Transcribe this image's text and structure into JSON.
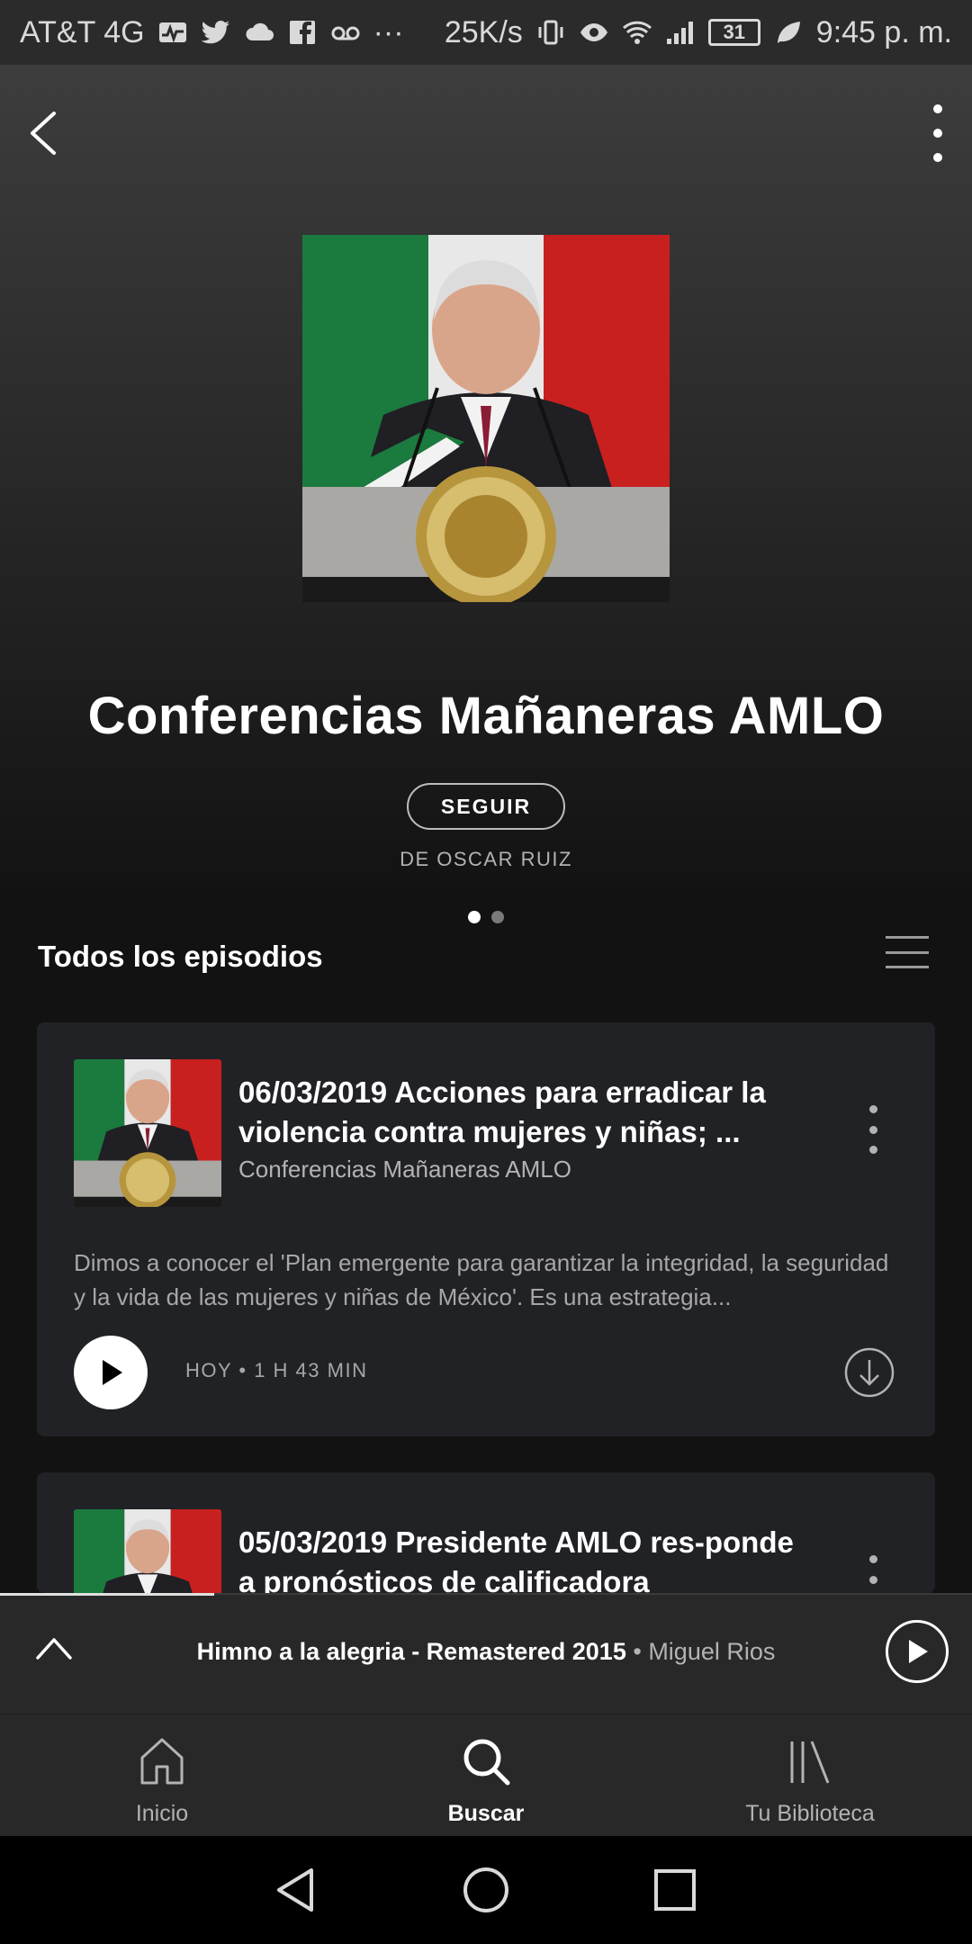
{
  "status_bar": {
    "carrier": "AT&T 4G",
    "speed": "25K/s",
    "battery": "31",
    "time": "9:45 p. m."
  },
  "header": {
    "back_icon": "chevron-left-icon",
    "more_icon": "more-vertical-icon"
  },
  "podcast": {
    "title": "Conferencias Mañaneras AMLO",
    "follow_label": "SEGUIR",
    "author": "DE OSCAR RUIZ",
    "cover_colors": {
      "green": "#1b7a3e",
      "white": "#e8e8e8",
      "red": "#c8201f"
    }
  },
  "episodes_section": {
    "title": "Todos los episodios",
    "filter_icon": "list-icon",
    "episodes": [
      {
        "title": "06/03/2019 Acciones para erradicar la violencia contra mujeres y niñas; ...",
        "show": "Conferencias Mañaneras AMLO",
        "description": "Dimos a conocer el 'Plan emergente para garantizar la integridad, la seguridad y la vida de las mujeres y niñas de México'. Es una estrategia...",
        "meta": "HOY • 1 H 43 MIN"
      },
      {
        "title": "05/03/2019 Presidente AMLO res-ponde a pronósticos de calificadora"
      }
    ]
  },
  "mini_player": {
    "track": "Himno a la alegria - Remastered 2015",
    "separator": " • ",
    "artist": "Miguel Rios",
    "progress": 0.22
  },
  "bottom_nav": {
    "items": [
      {
        "label": "Inicio",
        "icon": "home-icon"
      },
      {
        "label": "Buscar",
        "icon": "search-icon",
        "active": true
      },
      {
        "label": "Tu Biblioteca",
        "icon": "library-icon"
      }
    ]
  },
  "android_nav": {
    "back": "android-back-icon",
    "home": "android-home-icon",
    "recents": "android-recents-icon"
  }
}
